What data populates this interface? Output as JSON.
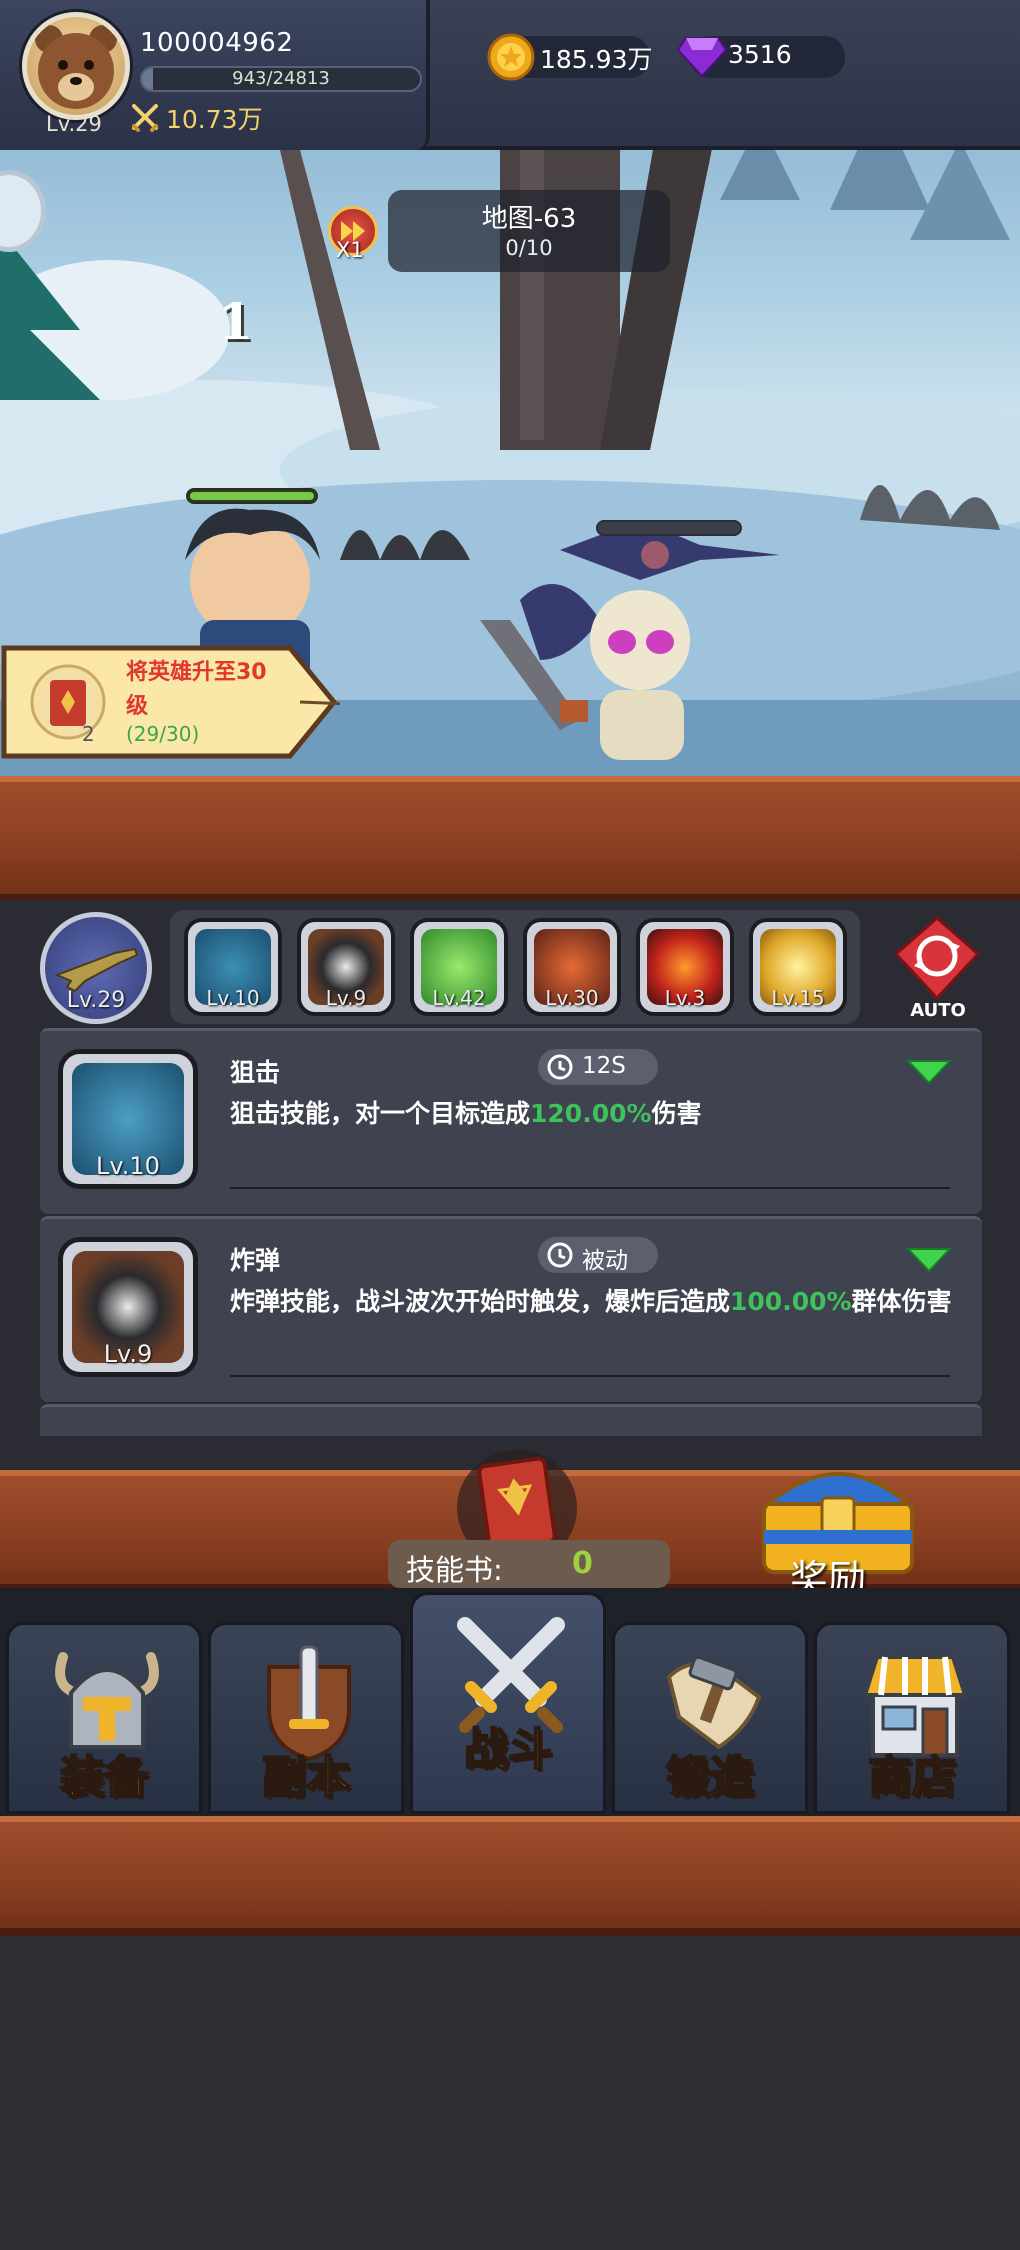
{
  "player": {
    "id": "100004962",
    "level_label": "Lv.29",
    "xp_text": "943/24813",
    "xp_fraction": 0.038,
    "power": "10.73万"
  },
  "currency": {
    "coins": "185.93万",
    "gems": "3516"
  },
  "battle": {
    "speed_label": "X1",
    "map_title": "地图-63",
    "map_progress": "0/10",
    "wave_number": "1"
  },
  "quest": {
    "text": "将英雄升至30级",
    "progress": "(29/30)",
    "count": "2"
  },
  "weapon": {
    "level": "Lv.29"
  },
  "skill_slots": [
    {
      "level": "Lv.10",
      "icon": "sniper-target-icon"
    },
    {
      "level": "Lv.9",
      "icon": "skull-bomb-icon"
    },
    {
      "level": "Lv.42",
      "icon": "green-heal-icon"
    },
    {
      "level": "Lv.30",
      "icon": "fire-creature-icon"
    },
    {
      "level": "Lv.3",
      "icon": "meteor-explosion-icon"
    },
    {
      "level": "Lv.15",
      "icon": "lightning-icon"
    }
  ],
  "auto_label": "AUTO",
  "skills": [
    {
      "name": "狙击",
      "tag": "12S",
      "icon_level": "Lv.10",
      "desc_before": "狙击技能，对一个目标造成",
      "desc_value": "120.00%",
      "desc_after": "伤害"
    },
    {
      "name": "炸弹",
      "tag": "被动",
      "icon_level": "Lv.9",
      "desc_before": "炸弹技能，战斗波次开始时触发，爆炸后造成",
      "desc_value": "100.00%",
      "desc_after": "群体伤害"
    }
  ],
  "skill_book": {
    "label": "技能书:",
    "value": "0"
  },
  "reward_label": "奖励",
  "nav": [
    {
      "label": "装备",
      "icon": "equipment-helmet-icon"
    },
    {
      "label": "副本",
      "icon": "dungeon-sword-shield-icon"
    },
    {
      "label": "战斗",
      "icon": "battle-crossed-swords-icon"
    },
    {
      "label": "锻造",
      "icon": "forge-scroll-hammer-icon"
    },
    {
      "label": "商店",
      "icon": "shop-store-icon"
    }
  ],
  "colors": {
    "highlight_green": "#3ec25c",
    "quest_red": "#e0382e",
    "nav_label_gold": "#f5d25a"
  }
}
